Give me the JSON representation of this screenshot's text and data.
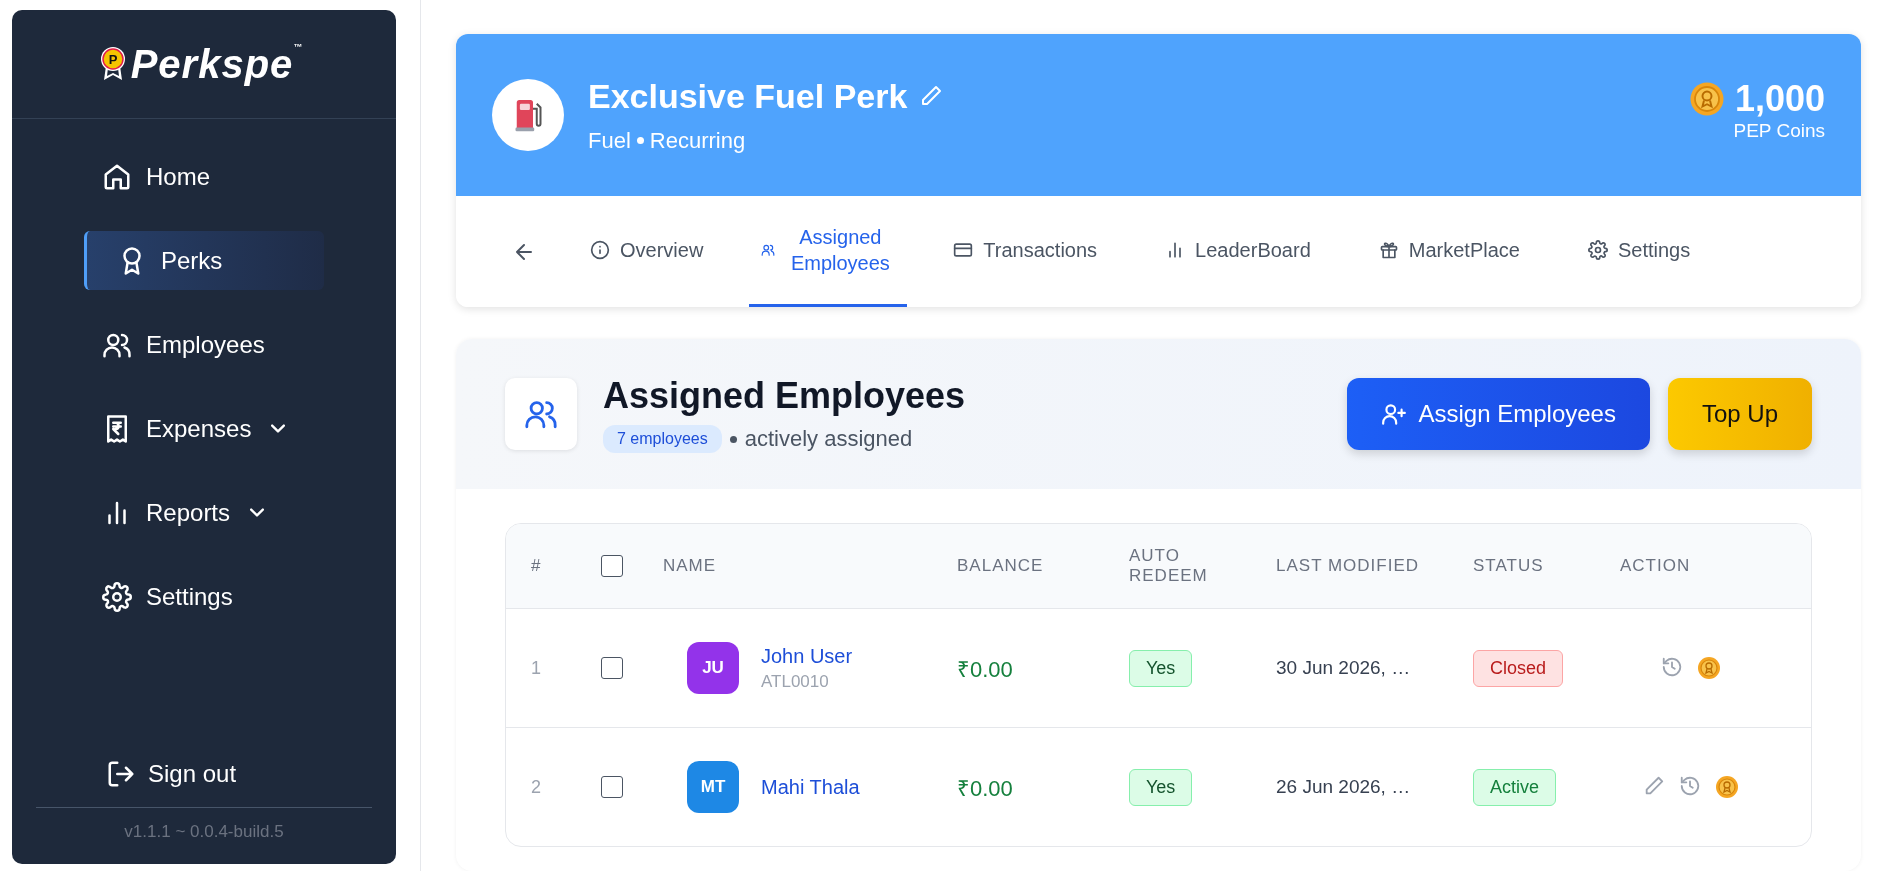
{
  "sidebar": {
    "logo": {
      "text": "Perkspe",
      "mark": "™",
      "badge": "P"
    },
    "items": [
      {
        "label": "Home",
        "kind": "home",
        "selected": false,
        "expandable": false
      },
      {
        "label": "Perks",
        "kind": "award",
        "selected": true,
        "expandable": false
      },
      {
        "label": "Employees",
        "kind": "users",
        "selected": false,
        "expandable": false
      },
      {
        "label": "Expenses",
        "kind": "receipt",
        "selected": false,
        "expandable": true
      },
      {
        "label": "Reports",
        "kind": "bars",
        "selected": false,
        "expandable": true
      },
      {
        "label": "Settings",
        "kind": "gear",
        "selected": false,
        "expandable": false
      }
    ],
    "sign_out": "Sign out",
    "version": "v1.1.1 ~ 0.0.4-build.5"
  },
  "perk": {
    "title": "Exclusive Fuel Perk",
    "category": "Fuel",
    "frequency": "Recurring",
    "coins": "1,000",
    "coins_label": "PEP Coins",
    "tabs": [
      {
        "label": "Overview",
        "kind": "info",
        "selected": false
      },
      {
        "label": "Assigned Employees",
        "kind": "users",
        "selected": true
      },
      {
        "label": "Transactions",
        "kind": "card",
        "selected": false
      },
      {
        "label": "LeaderBoard",
        "kind": "bars",
        "selected": false
      },
      {
        "label": "MarketPlace",
        "kind": "gift",
        "selected": false
      },
      {
        "label": "Settings",
        "kind": "gear",
        "selected": false
      }
    ]
  },
  "section": {
    "title": "Assigned Employees",
    "count": "7 employees",
    "note": "actively assigned",
    "buttons": [
      {
        "label": "Assign Employees",
        "kind": "primary"
      },
      {
        "label": "Top Up",
        "kind": "accent"
      }
    ]
  },
  "table": {
    "columns": [
      "#",
      "NAME",
      "BALANCE",
      "AUTO REDEEM",
      "LAST MODIFIED",
      "STATUS",
      "ACTION"
    ],
    "select_all": {
      "checked": false
    },
    "rows": [
      {
        "index": "1",
        "checked": false,
        "initials": "JU",
        "color": "#9333ea",
        "name": "John User",
        "code": "ATL0010",
        "balance": "₹0.00",
        "auto_redeem": "Yes",
        "modified": "30 Jun 2026, …",
        "status": {
          "label": "Closed",
          "kind": "closed"
        },
        "actions": [
          {
            "kind": "history"
          },
          {
            "kind": "coin"
          }
        ]
      },
      {
        "index": "2",
        "checked": false,
        "initials": "MT",
        "color": "#1e88e5",
        "name": "Mahi Thala",
        "balance": "₹0.00",
        "auto_redeem": "Yes",
        "modified": "26 Jun 2026, …",
        "status": {
          "label": "Active",
          "kind": "active"
        },
        "actions": [
          {
            "kind": "edit"
          },
          {
            "kind": "history"
          },
          {
            "kind": "coin"
          }
        ]
      }
    ]
  }
}
